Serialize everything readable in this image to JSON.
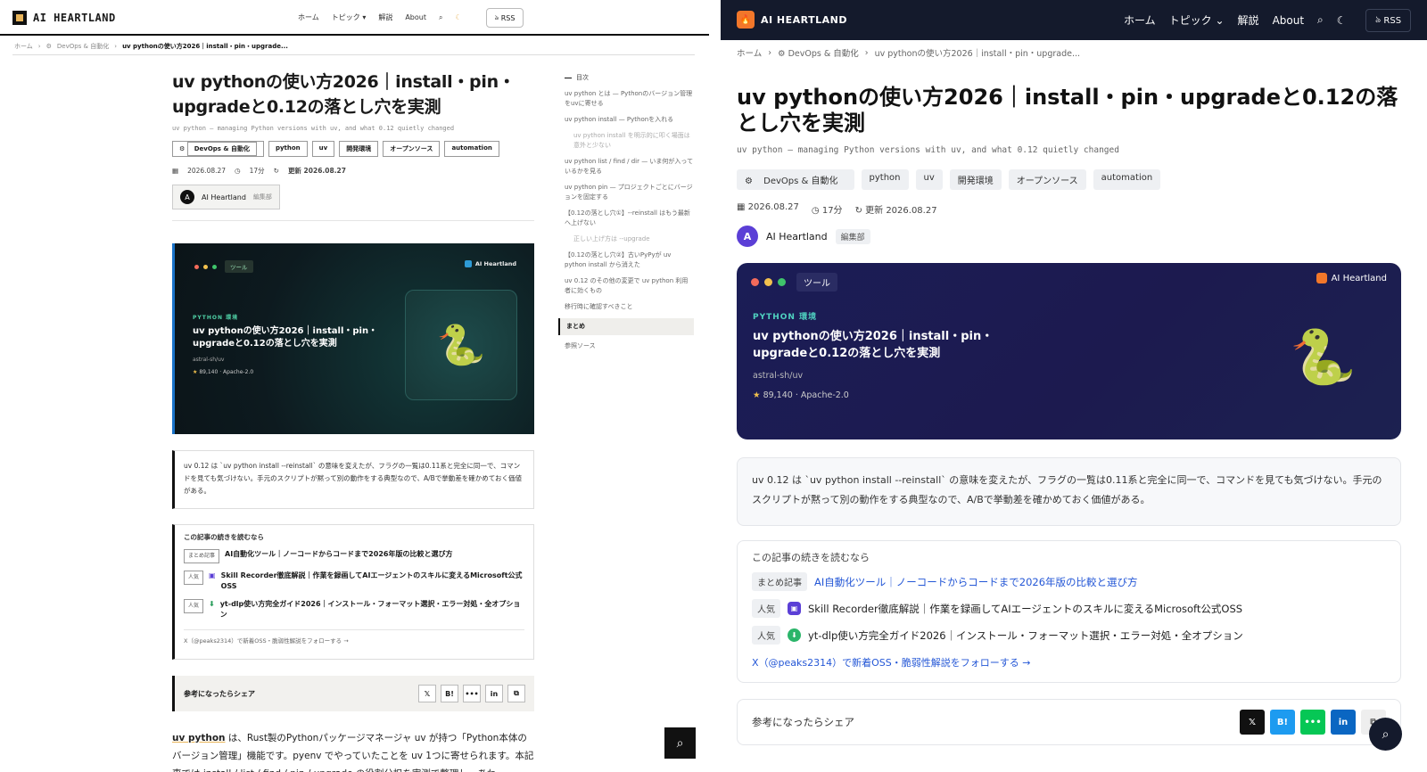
{
  "brand": "AI HEARTLAND",
  "nav": {
    "home": "ホーム",
    "topics": "トピック",
    "explain": "解説",
    "about": "About",
    "rss": "RSS"
  },
  "breadcrumb": {
    "home": "ホーム",
    "category": "DevOps & 自動化",
    "current": "uv pythonの使い方2026｜install・pin・upgrade..."
  },
  "article": {
    "title": "uv pythonの使い方2026｜install・pin・upgradeと0.12の落とし穴を実測",
    "subtitle": "uv python — managing Python versions with uv, and what 0.12 quietly changed",
    "tags": [
      "DevOps & 自動化",
      "python",
      "uv",
      "開発環境",
      "オープンソース",
      "automation"
    ],
    "date": "2026.08.27",
    "read": "17分",
    "updated": "更新 2026.08.27",
    "author": "AI Heartland",
    "author_initial": "A",
    "author_role": "編集部"
  },
  "hero": {
    "tag": "ツール",
    "brand": "AI Heartland",
    "kicker": "PYTHON 環境",
    "title": "uv pythonの使い方2026｜install・pin・upgradeと0.12の落とし穴を実測",
    "repo": "astral-sh/uv",
    "stars": "89,140",
    "license": "Apache-2.0"
  },
  "summary": "uv 0.12 は `uv python install --reinstall` の意味を変えたが、フラグの一覧は0.11系と完全に同一で、コマンドを見ても気づけない。手元のスクリプトが黙って別の動作をする典型なので、A/Bで挙動差を確かめておく価値がある。",
  "continue": {
    "heading": "この記事の続きを読むなら",
    "items": [
      {
        "badge": "まとめ記事",
        "text": "AI自動化ツール｜ノーコードからコードまで2026年版の比較と選び方"
      },
      {
        "badge": "人気",
        "text": "Skill Recorder徹底解説｜作業を録画してAIエージェントのスキルに変えるMicrosoft公式OSS"
      },
      {
        "badge": "人気",
        "text": "yt-dlp使い方完全ガイド2026｜インストール・フォーマット選択・エラー対処・全オプション"
      }
    ],
    "follow_left": "X（@peaks2314）で新着OSS・脆弱性解説をフォローする →",
    "follow_right": "X（@peaks2314）で新着OSS・脆弱性解説をフォローする →"
  },
  "share": {
    "label": "参考になったらシェア",
    "x": "𝕏",
    "hatena": "B!",
    "line": "•••",
    "linkedin": "in",
    "copy": "⧉"
  },
  "body": {
    "bold": "uv python",
    "text": " は、Rust製のPythonパッケージマネージャ uv が持つ「Python本体のバージョン管理」機能です。pyenv でやっていたことを uv 1つに寄せられます。本記事では install / list / find / pin / upgrade の役割分担を実測で整理し、あわ"
  },
  "toc": {
    "heading": "目次",
    "items": [
      {
        "text": "uv python とは — Pythonのバージョン管理をuvに寄せる",
        "level": 1
      },
      {
        "text": "uv python install — Pythonを入れる",
        "level": 1
      },
      {
        "text": "uv python install を明示的に叩く場面は意外と少ない",
        "level": 2
      },
      {
        "text": "uv python list / find / dir — いま何が入っているかを見る",
        "level": 1
      },
      {
        "text": "uv python pin — プロジェクトごとにバージョンを固定する",
        "level": 1
      },
      {
        "text": "【0.12の落とし穴①】--reinstall はもう最新へ上げない",
        "level": 1
      },
      {
        "text": "正しい上げ方は --upgrade",
        "level": 2
      },
      {
        "text": "【0.12の落とし穴②】古いPyPyが uv python install から消えた",
        "level": 1
      },
      {
        "text": "uv 0.12 のその他の変更で uv python 利用者に効くもの",
        "level": 1
      },
      {
        "text": "移行時に確認すべきこと",
        "level": 1
      },
      {
        "text": "まとめ",
        "level": 1
      },
      {
        "text": "参照ソース",
        "level": 1
      }
    ]
  },
  "icons": {
    "search": "search-icon",
    "theme": "moon-icon",
    "calendar": "calendar-icon",
    "clock": "clock-icon",
    "refresh": "refresh-icon",
    "star": "star-icon",
    "gear": "gear-icon"
  },
  "colors": {
    "right_header": "#141a2c",
    "accent_orange": "#f2772a",
    "hero_teal": "#4fd1c0",
    "link_blue": "#2457d6"
  }
}
